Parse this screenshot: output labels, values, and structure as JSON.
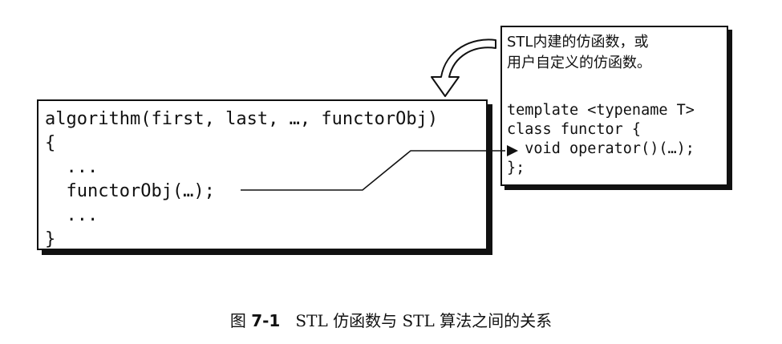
{
  "left_code": {
    "line1": "algorithm(first, last, …, functorObj)",
    "line2": "{",
    "line3": "  ...",
    "line4": "  functorObj(…);",
    "line5": "  ...",
    "line6": "}"
  },
  "right_box": {
    "note_line1": "STL内建的仿函数，或",
    "note_line2": "用户自定义的仿函数。",
    "code_line1": "template <typename T>",
    "code_line2": "class functor {",
    "code_line3": "  void operator()(…);",
    "code_line4": "};"
  },
  "caption": {
    "prefix": "图 ",
    "number": "7-1",
    "text": "   STL 仿函数与 STL 算法之间的关系"
  }
}
